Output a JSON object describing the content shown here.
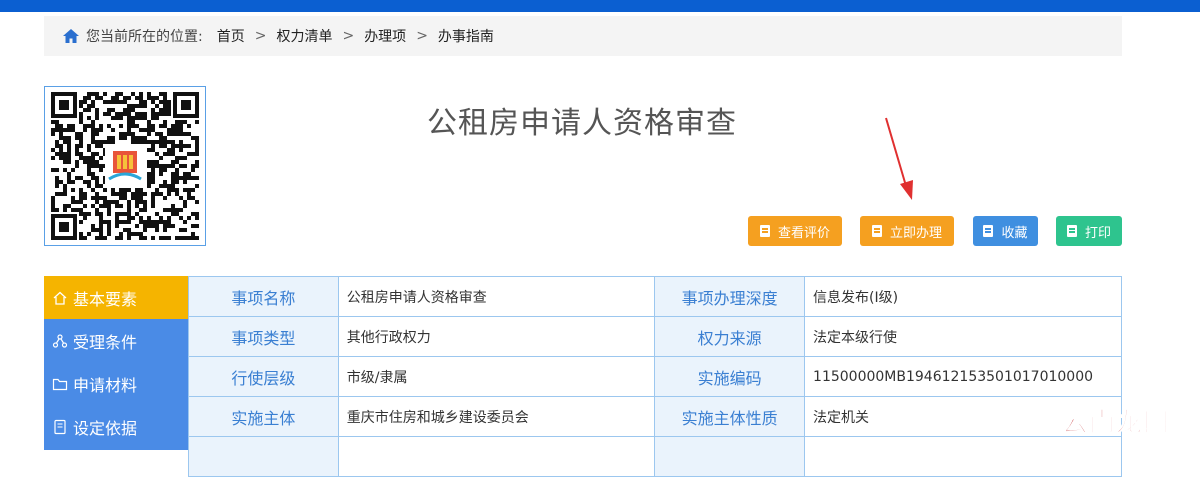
{
  "breadcrumb": {
    "label": "您当前所在的位置:",
    "items": [
      "首页",
      "权力清单",
      "办理项",
      "办事指南"
    ],
    "separator": ">"
  },
  "page_title": "公租房申请人资格审查",
  "buttons": {
    "review": "查看评价",
    "apply": "立即办理",
    "favorite": "收藏",
    "print": "打印"
  },
  "sidebar": {
    "items": [
      {
        "label": "基本要素",
        "icon": "home-icon",
        "active": true
      },
      {
        "label": "受理条件",
        "icon": "network-icon",
        "active": false
      },
      {
        "label": "申请材料",
        "icon": "folder-icon",
        "active": false
      },
      {
        "label": "设定依据",
        "icon": "document-icon",
        "active": false
      }
    ]
  },
  "table": {
    "rows": [
      {
        "k1": "事项名称",
        "v1": "公租房申请人资格审查",
        "k2": "事项办理深度",
        "v2": "信息发布(Ⅰ级)"
      },
      {
        "k1": "事项类型",
        "v1": "其他行政权力",
        "k2": "权力来源",
        "v2": "法定本级行使"
      },
      {
        "k1": "行使层级",
        "v1": "市级/隶属",
        "k2": "实施编码",
        "v2": "11500000MB194612153501017010000"
      },
      {
        "k1": "实施主体",
        "v1": "重庆市住房和城乡建设委员会",
        "k2": "实施主体性质",
        "v2": "法定机关"
      }
    ]
  },
  "watermark": "云南龙网",
  "colors": {
    "topbar": "#0b5fd1",
    "orange": "#f5a020",
    "blue": "#3f8fe0",
    "green": "#2ec48e",
    "sidebar": "#4a8be6",
    "sidebar_active": "#f5b400"
  }
}
